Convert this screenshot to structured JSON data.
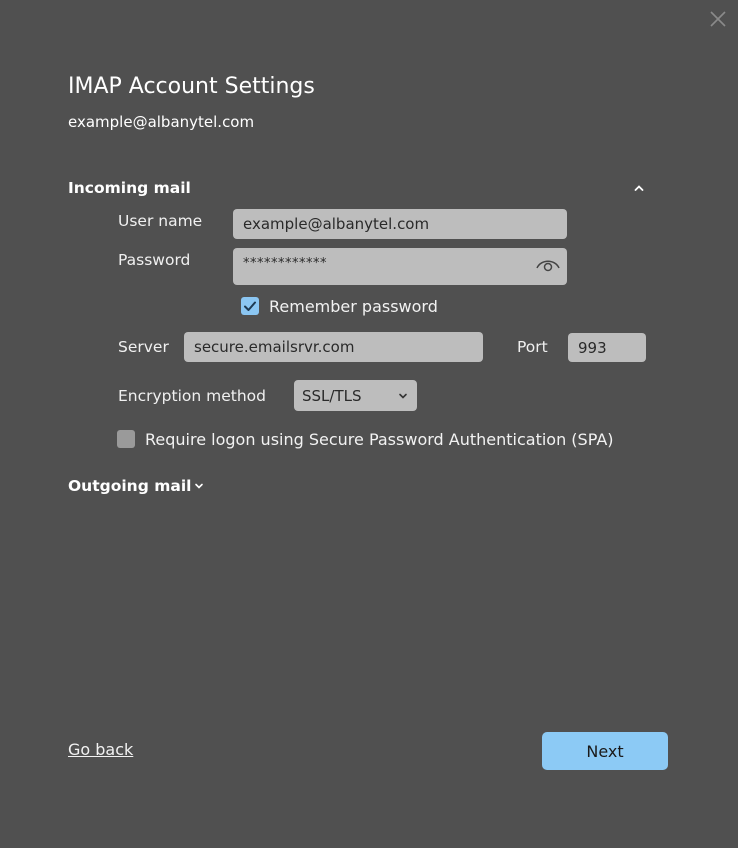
{
  "window": {
    "close_icon": "close-icon"
  },
  "header": {
    "title": "IMAP Account Settings",
    "email": "example@albanytel.com"
  },
  "incoming": {
    "section_label": "Incoming mail",
    "collapse_icon": "chevron-up-icon",
    "username_label": "User name",
    "username_value": "example@albanytel.com",
    "password_label": "Password",
    "password_value": "************",
    "show_password_icon": "eye-icon",
    "remember_label": "Remember password",
    "remember_checked": true,
    "server_label": "Server",
    "server_value": "secure.emailsrvr.com",
    "port_label": "Port",
    "port_value": "993",
    "encryption_label": "Encryption method",
    "encryption_value": "SSL/TLS",
    "spa_label": "Require logon using Secure Password Authentication (SPA)",
    "spa_checked": false
  },
  "outgoing": {
    "section_label": "Outgoing mail",
    "expand_icon": "chevron-down-icon"
  },
  "footer": {
    "back_label": "Go back",
    "next_label": "Next"
  },
  "colors": {
    "background": "#505050",
    "field": "#bdbdbd",
    "accent": "#8ccaf5"
  }
}
